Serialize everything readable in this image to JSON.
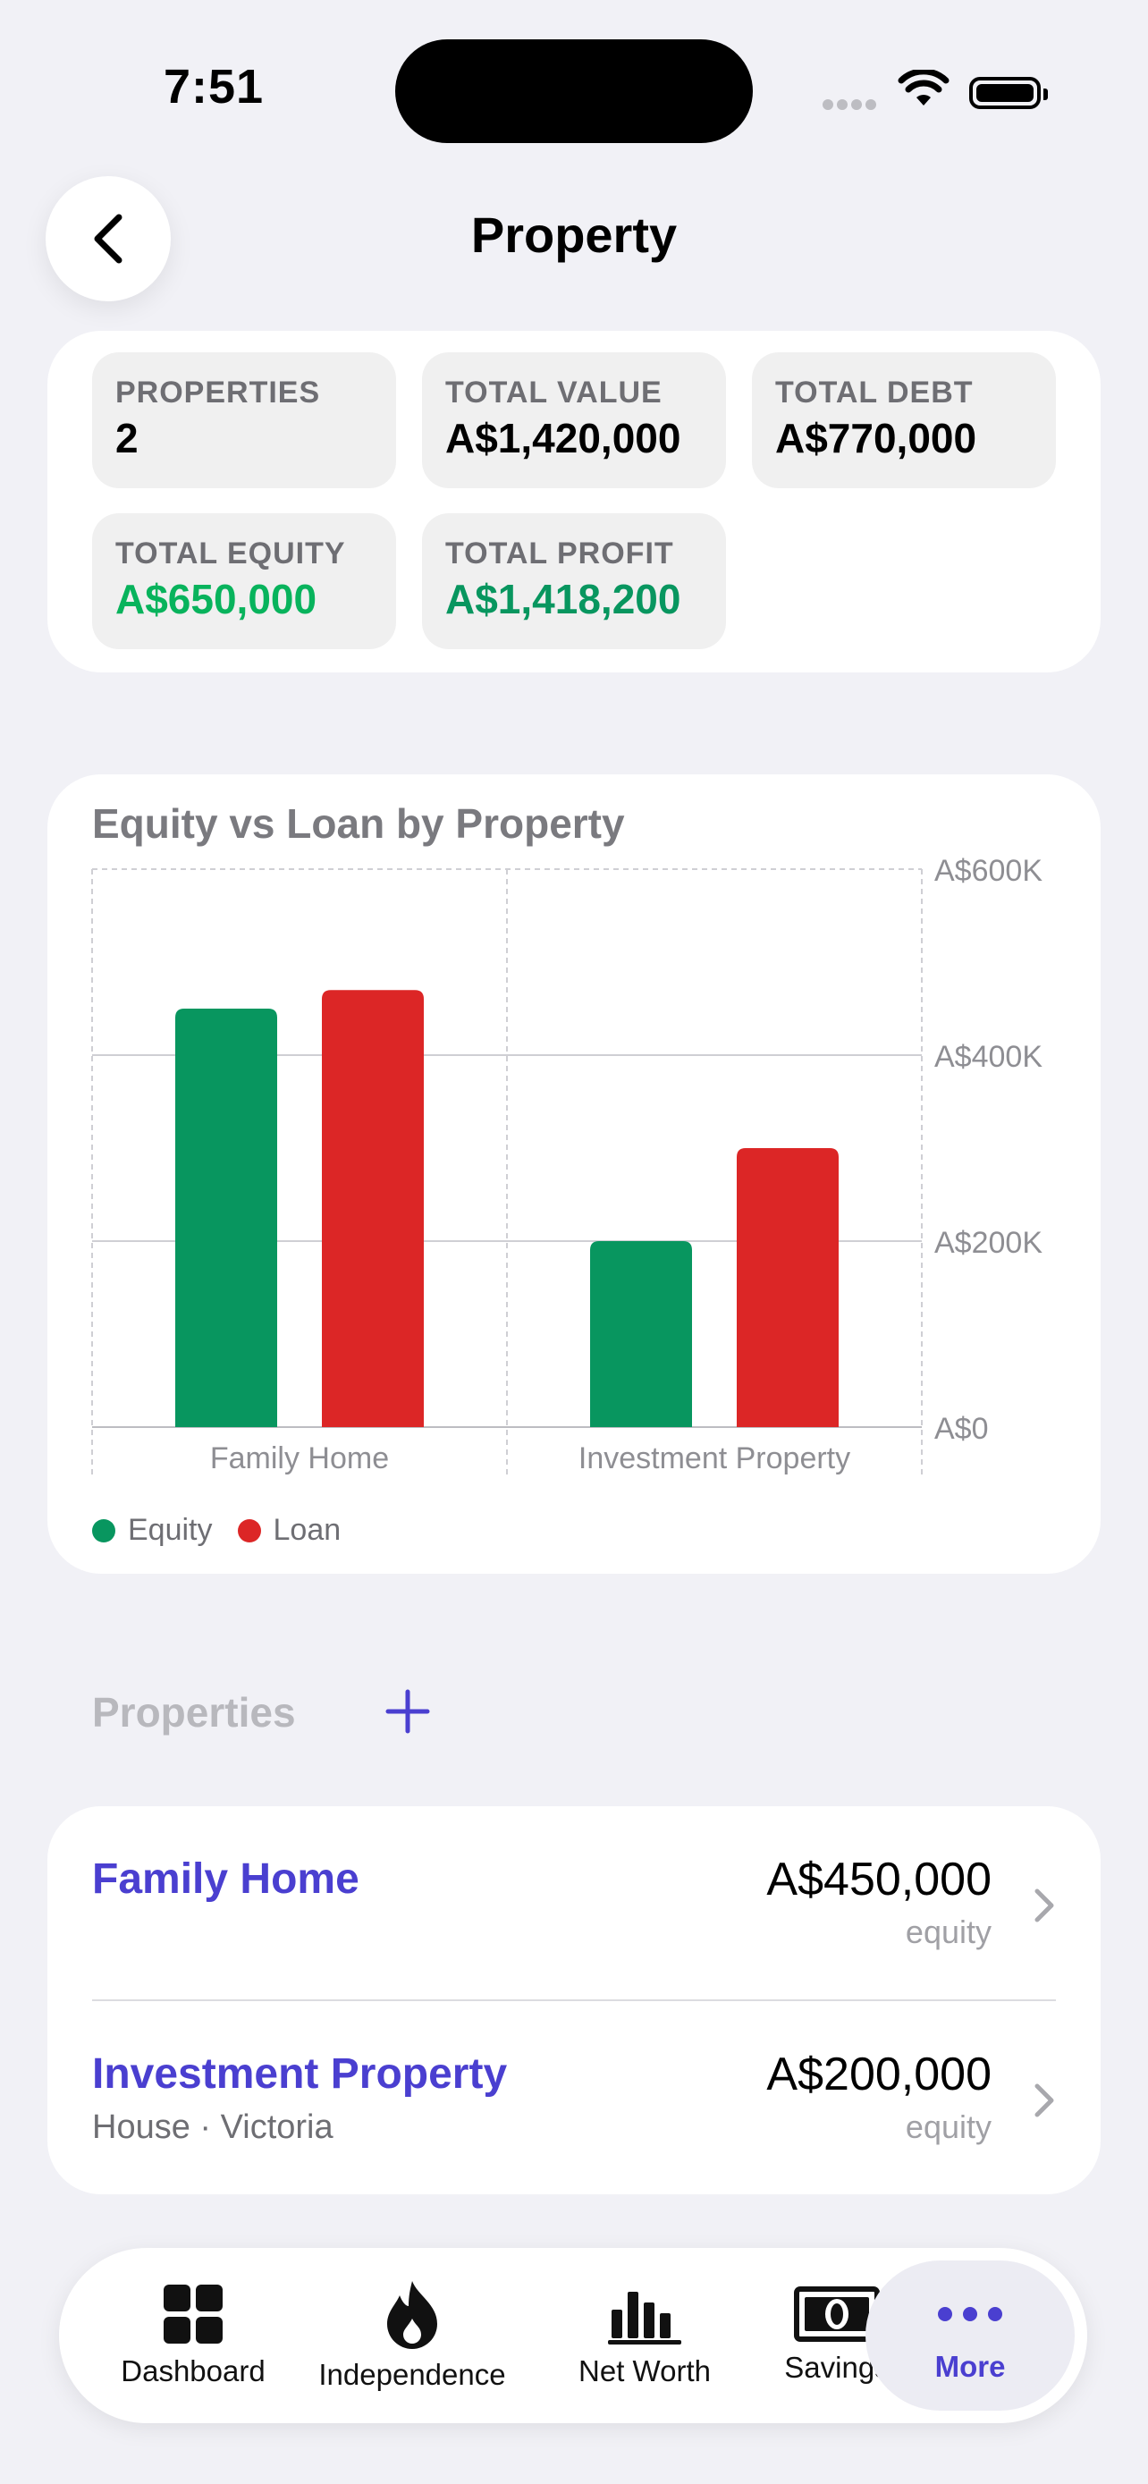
{
  "status_bar": {
    "time": "7:51"
  },
  "nav": {
    "title": "Property"
  },
  "summary": {
    "tiles": [
      {
        "label": "PROPERTIES",
        "value": "2"
      },
      {
        "label": "TOTAL VALUE",
        "value": "A$1,420,000"
      },
      {
        "label": "TOTAL DEBT",
        "value": "A$770,000"
      },
      {
        "label": "TOTAL EQUITY",
        "value": "A$650,000"
      },
      {
        "label": "TOTAL PROFIT",
        "value": "A$1,418,200"
      }
    ]
  },
  "chart": {
    "title": "Equity vs Loan by Property"
  },
  "chart_data": {
    "type": "bar",
    "title": "Equity vs Loan by Property",
    "categories": [
      "Family Home",
      "Investment Property"
    ],
    "series": [
      {
        "name": "Equity",
        "values": [
          450000,
          200000
        ],
        "color": "#08965f"
      },
      {
        "name": "Loan",
        "values": [
          470000,
          300000
        ],
        "color": "#dc2626"
      }
    ],
    "ylim": [
      0,
      600000
    ],
    "yticks": [
      {
        "value": 0,
        "label": "A$0"
      },
      {
        "value": 200000,
        "label": "A$200K"
      },
      {
        "value": 400000,
        "label": "A$400K"
      },
      {
        "value": 600000,
        "label": "A$600K"
      }
    ],
    "legend_position": "bottom-left",
    "y_axis_side": "right",
    "grid": true
  },
  "properties": {
    "section_title": "Properties",
    "items": [
      {
        "name": "Family Home",
        "subtitle": "",
        "amount": "A$450,000",
        "unit": "equity"
      },
      {
        "name": "Investment Property",
        "subtitle": "House · Victoria",
        "amount": "A$200,000",
        "unit": "equity"
      }
    ]
  },
  "tabbar": {
    "tabs": [
      {
        "label": "Dashboard",
        "icon": "grid-icon"
      },
      {
        "label": "Independence",
        "icon": "flame-icon"
      },
      {
        "label": "Net Worth",
        "icon": "bar-chart-icon"
      },
      {
        "label": "Savings",
        "icon": "banknote-icon"
      },
      {
        "label": "More",
        "icon": "ellipsis-icon",
        "active": true
      }
    ]
  },
  "colors": {
    "accent": "#4a3fd0",
    "equity": "#08965f",
    "loan": "#dc2626"
  }
}
